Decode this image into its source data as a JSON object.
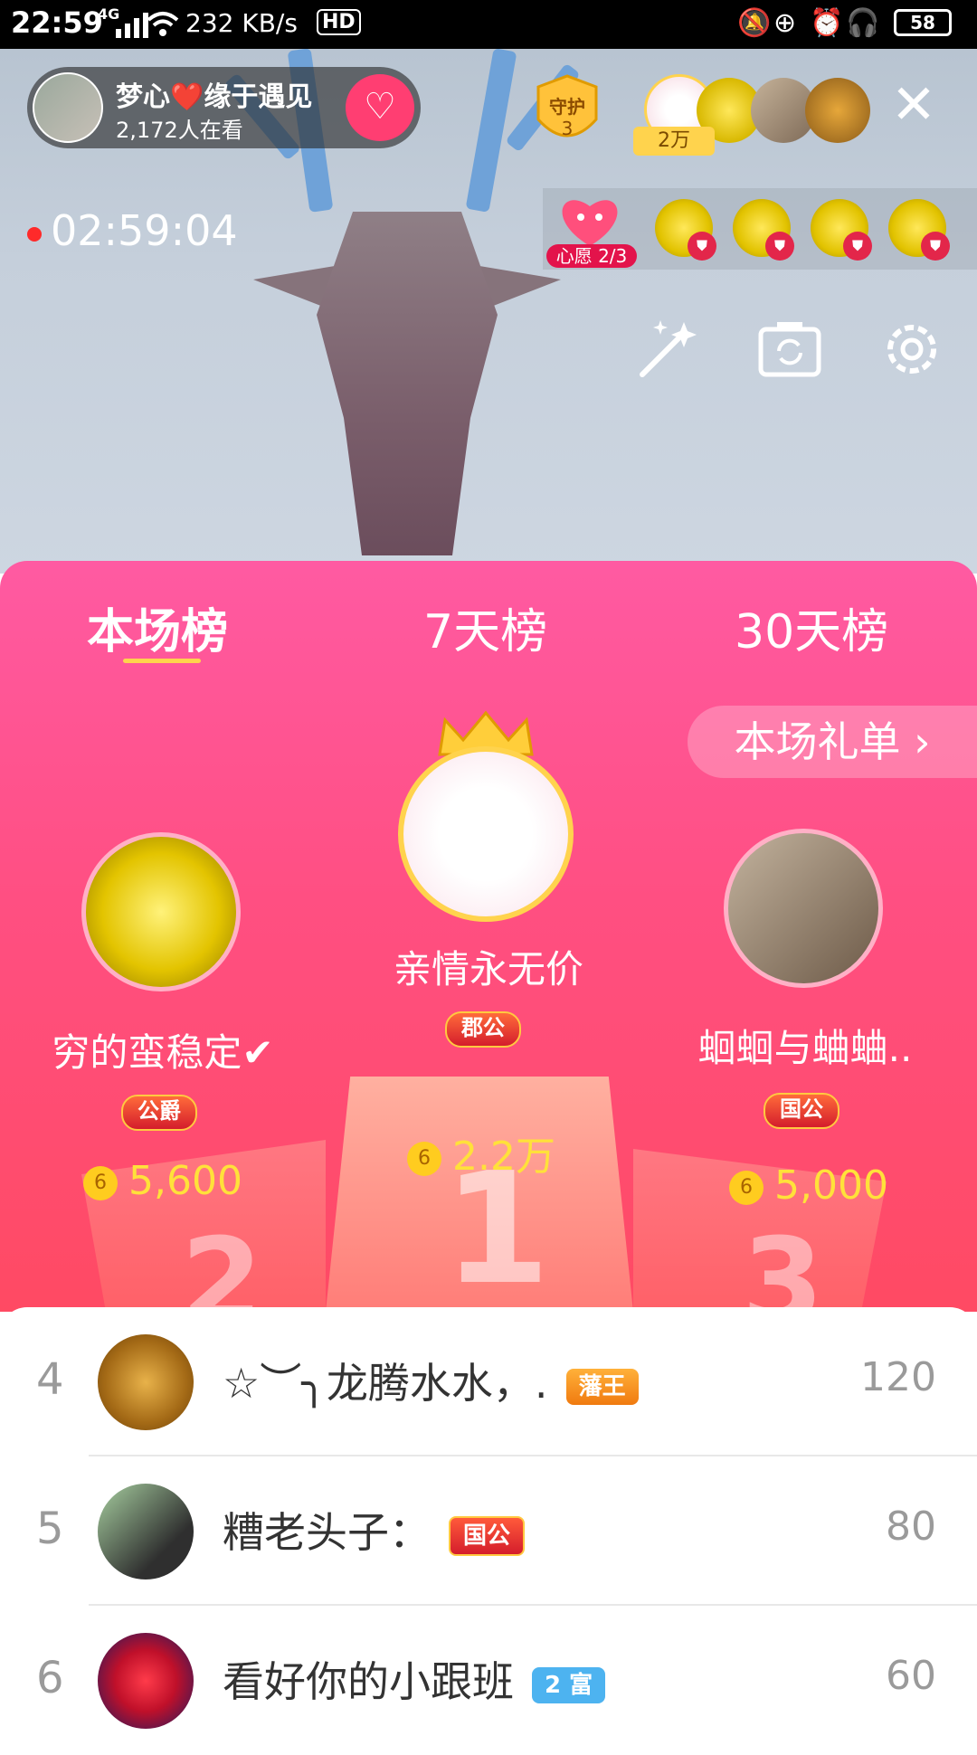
{
  "status_bar": {
    "time": "22:59",
    "network": "4G",
    "speed": "232 KB/s",
    "hd": "HD",
    "battery": "58"
  },
  "host": {
    "name": "梦心❤️缘于遇见",
    "viewers": "2,172人在看"
  },
  "guard": {
    "label": "守护",
    "count": "3"
  },
  "top_fans": {
    "count_label": "2万"
  },
  "timer": "02:59:04",
  "wish": {
    "label": "心愿 2/3"
  },
  "tabs": [
    {
      "label": "本场榜"
    },
    {
      "label": "7天榜"
    },
    {
      "label": "30天榜"
    }
  ],
  "gift_list_button": "本场礼单 ›",
  "podium": {
    "first": {
      "name": "亲情永无价",
      "badge": "郡公",
      "score": "2.2万",
      "rank": "1"
    },
    "second": {
      "name": "穷的蛮稳定✔",
      "badge": "公爵",
      "score": "5,600",
      "rank": "2"
    },
    "third": {
      "name": "蛔蛔与蛐蛐..",
      "badge": "国公",
      "score": "5,000",
      "rank": "3"
    }
  },
  "coin_symbol": "6",
  "list": [
    {
      "rank": "4",
      "name": "☆︶╮龙腾水水，.",
      "badge": "藩王",
      "score": "120"
    },
    {
      "rank": "5",
      "name": "糟老头子：",
      "badge": "国公",
      "score": "80"
    },
    {
      "rank": "6",
      "name": "看好你的小跟班",
      "badge": "2 富",
      "score": "60"
    }
  ],
  "colors": {
    "board_top": "#ff5aa2",
    "board_bottom": "#ff4a63",
    "score_yellow": "#ffe13a",
    "follow_pink": "#ff3e72"
  }
}
